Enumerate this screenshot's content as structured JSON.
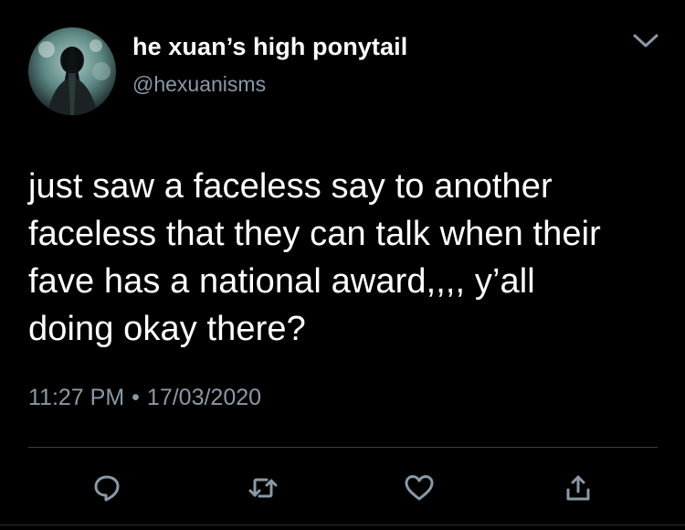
{
  "tweet": {
    "display_name": "he xuan’s high ponytail",
    "handle": "@hexuanisms",
    "text": "just saw a faceless say to another\nfaceless that they can talk when their\nfave has a national award,,,, y’all\ndoing okay there?",
    "time": "11:27 PM",
    "separator": "•",
    "date": "17/03/2020"
  },
  "actions": [
    {
      "name": "reply",
      "icon": "reply-icon"
    },
    {
      "name": "retweet",
      "icon": "retweet-icon"
    },
    {
      "name": "like",
      "icon": "heart-icon"
    },
    {
      "name": "share",
      "icon": "share-icon"
    }
  ],
  "colors": {
    "background": "#000000",
    "primary_text": "#ffffff",
    "secondary_text": "#8b98a5",
    "divider": "#3b4048"
  }
}
